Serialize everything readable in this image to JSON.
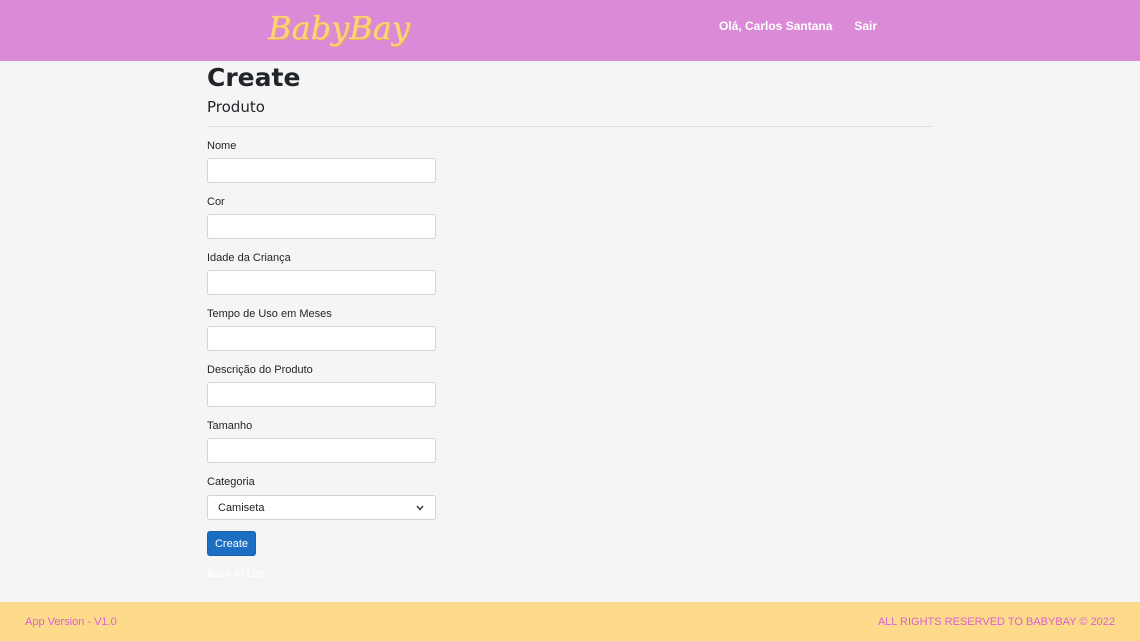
{
  "header": {
    "brand": "BabyBay",
    "greeting": "Olá, Carlos Santana",
    "logout": "Sair"
  },
  "page": {
    "title": "Create",
    "subtitle": "Produto"
  },
  "form": {
    "fields": [
      {
        "label": "Nome",
        "value": ""
      },
      {
        "label": "Cor",
        "value": ""
      },
      {
        "label": "Idade da Criança",
        "value": ""
      },
      {
        "label": "Tempo de Uso em Meses",
        "value": ""
      },
      {
        "label": "Descrição do Produto",
        "value": ""
      },
      {
        "label": "Tamanho",
        "value": ""
      }
    ],
    "category": {
      "label": "Categoria",
      "selected": "Camiseta"
    },
    "submit_label": "Create",
    "back_label": "Back to List"
  },
  "footer": {
    "version": "App Version - V1.0",
    "rights": "ALL RIGHTS RESERVED TO BABYBAY © 2022"
  },
  "colors": {
    "navbar": "#da8ad6",
    "brand": "#fdd47c",
    "footer": "#fddb8a",
    "footer_text": "#da5fd2",
    "primary_button": "#1b6ec2"
  }
}
